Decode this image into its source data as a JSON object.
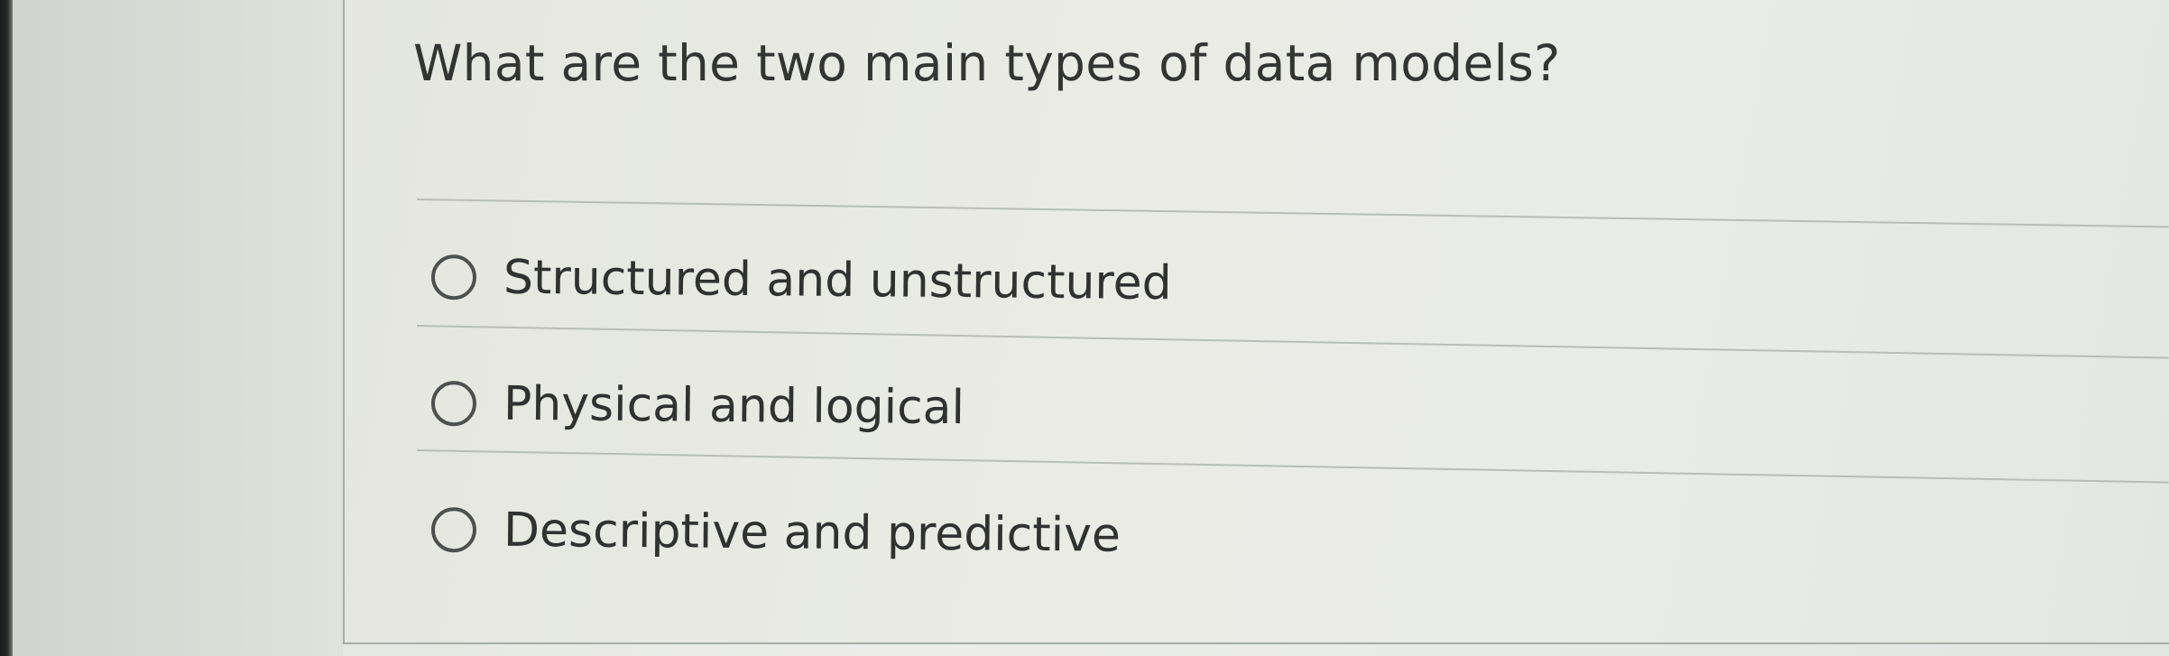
{
  "question": {
    "text": "What are the two main types of data models?"
  },
  "options": [
    {
      "label": "Structured and unstructured",
      "selected": false
    },
    {
      "label": "Physical and logical",
      "selected": false
    },
    {
      "label": "Descriptive and predictive",
      "selected": false
    }
  ],
  "colors": {
    "text": "#333534",
    "divider": "#b9bdb7",
    "radio_border": "#4d504e",
    "background": "#e8eae5"
  }
}
